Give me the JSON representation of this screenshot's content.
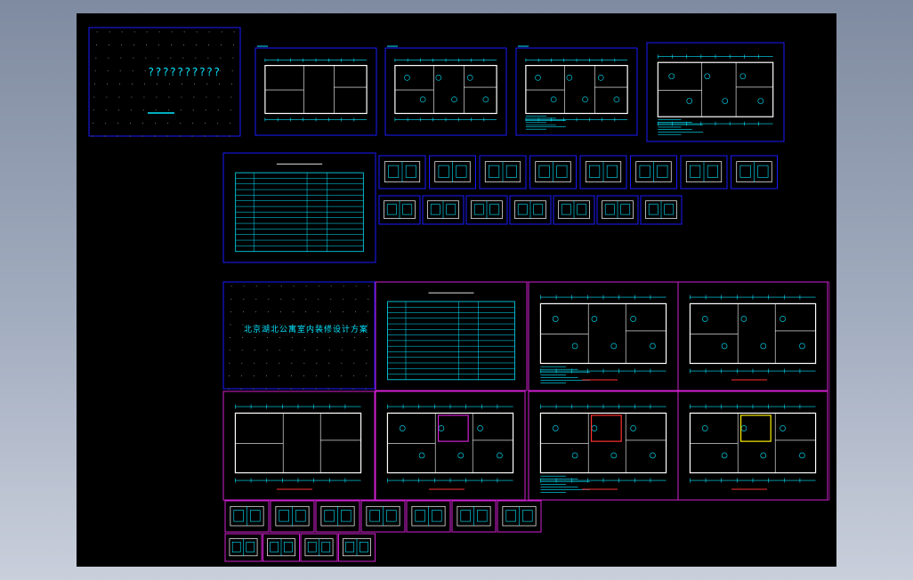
{
  "drawing": {
    "cover_sheet_title": "??????????",
    "cover_sheet_title_2": "北京湖北公寓室内装修设计方案"
  },
  "colors": {
    "background": "#000000",
    "frame_blue": "#1a1aff",
    "frame_magenta": "#d020d0",
    "line_cyan": "#00e5ff",
    "line_white": "#ffffff",
    "accent_yellow": "#ffee00",
    "accent_red": "#ff3030"
  }
}
